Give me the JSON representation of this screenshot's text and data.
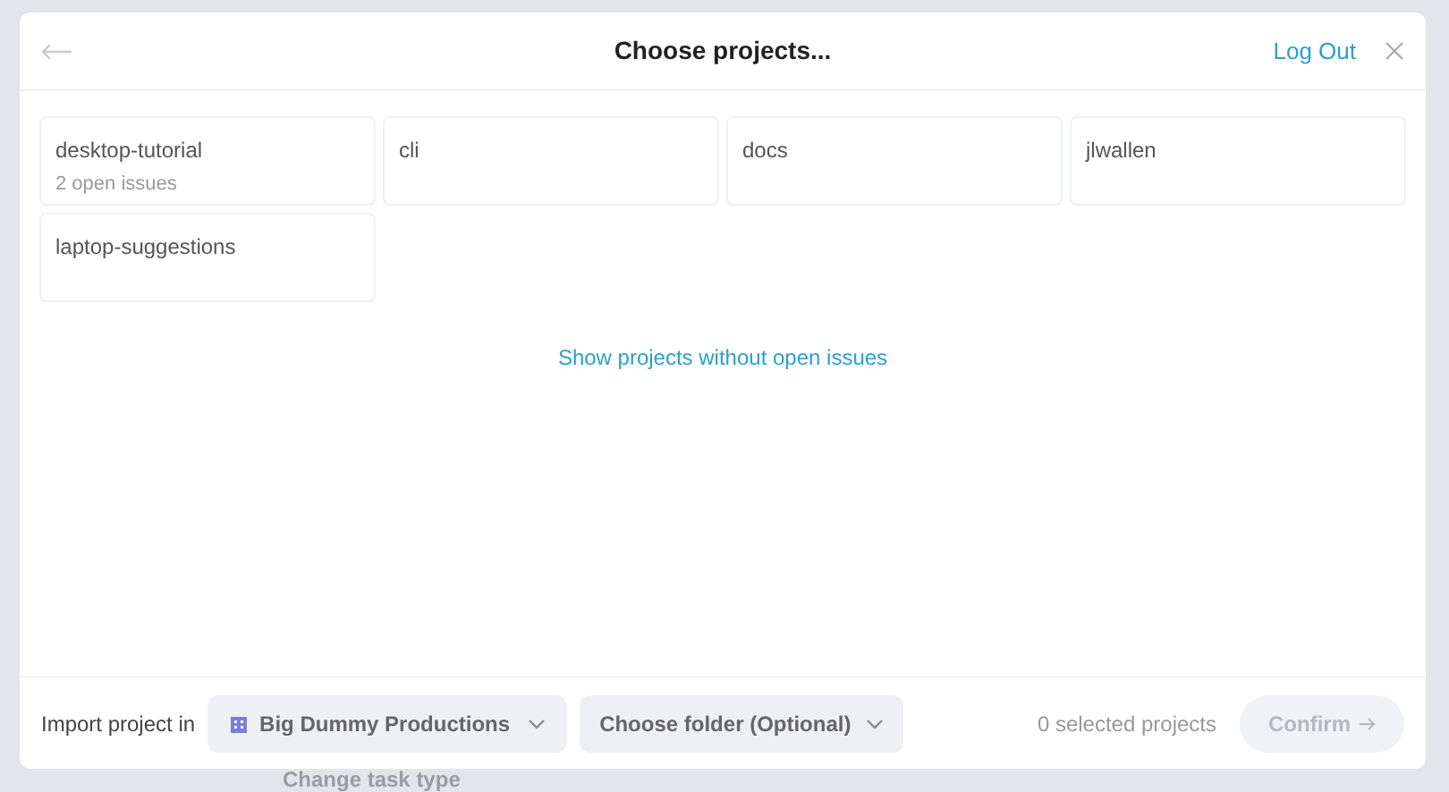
{
  "background": {
    "text": "Change task type"
  },
  "dialog": {
    "title": "Choose projects...",
    "logout": "Log Out",
    "projects": [
      {
        "name": "desktop-tutorial",
        "issues": "2 open issues"
      },
      {
        "name": "cli"
      },
      {
        "name": "docs"
      },
      {
        "name": "jlwallen"
      },
      {
        "name": "laptop-suggestions"
      }
    ],
    "show_link": "Show projects without open issues",
    "footer": {
      "import_label": "Import project in",
      "workspace": "Big Dummy Productions",
      "folder": "Choose folder (Optional)",
      "selected_count": "0 selected projects",
      "confirm": {
        "label": "Confirm",
        "disabled": true
      }
    }
  }
}
